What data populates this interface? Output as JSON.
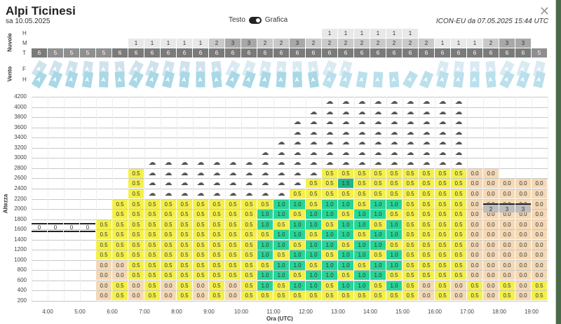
{
  "header": {
    "title": "Alpi Ticinesi",
    "date": "sa 10.05.2025",
    "toggle_left": "Testo",
    "toggle_right": "Grafica",
    "model": "ICON-EU da 07.05.2025 15:44 UTC",
    "close_icon": "close-icon"
  },
  "clouds": {
    "group_label": "Nuvole",
    "rows": [
      "H",
      "M",
      "T"
    ],
    "H": [
      "",
      "",
      "",
      "",
      "",
      "",
      "",
      "",
      "",
      "",
      "",
      "",
      "",
      "",
      "",
      "",
      "",
      "",
      "1",
      "1",
      "1",
      "1",
      "1",
      "1",
      "",
      "",
      "",
      "",
      "",
      "",
      "",
      ""
    ],
    "M": [
      "",
      "",
      "",
      "",
      "",
      "",
      "1",
      "1",
      "1",
      "1",
      "1",
      "2",
      "3",
      "3",
      "2",
      "2",
      "3",
      "2",
      "2",
      "2",
      "2",
      "2",
      "2",
      "2",
      "2",
      "1",
      "1",
      "1",
      "2",
      "3",
      "3",
      ""
    ],
    "T": [
      "6",
      "5",
      "5",
      "5",
      "5",
      "6",
      "6",
      "6",
      "6",
      "6",
      "6",
      "6",
      "6",
      "6",
      "6",
      "6",
      "6",
      "6",
      "6",
      "6",
      "6",
      "6",
      "6",
      "6",
      "6",
      "6",
      "6",
      "6",
      "6",
      "6",
      "6",
      "5"
    ]
  },
  "wind": {
    "group_label": "Vento",
    "rows": [
      "F",
      "H"
    ]
  },
  "chart_data": {
    "type": "table",
    "ylabel": "Altezza",
    "xlabel": "Ora (UTC)",
    "y_ticks": [
      4200,
      4000,
      3800,
      3600,
      3400,
      3200,
      3000,
      2800,
      2600,
      2400,
      2200,
      2000,
      1800,
      1600,
      1400,
      1200,
      1000,
      800,
      600,
      400,
      200
    ],
    "x_ticks": [
      "4:00",
      "5:00",
      "6:00",
      "7:00",
      "8:00",
      "9:00",
      "10:00",
      "11:00",
      "12:00",
      "13:00",
      "14:00",
      "15:00",
      "16:00",
      "17:00",
      "18:00",
      "19:00"
    ],
    "freezing_level": [
      "0",
      "0",
      "0",
      "0"
    ],
    "cloud_layer_labels": [
      "2",
      "3",
      "3"
    ],
    "legend_values": [
      "0.0",
      "0.5",
      "1.0",
      "1.5"
    ]
  }
}
